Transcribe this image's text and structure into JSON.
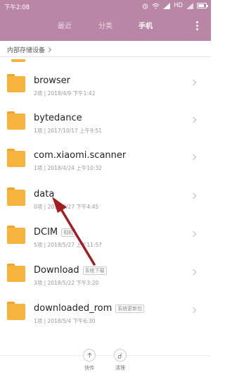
{
  "status": {
    "time": "下午2:08",
    "network": "HD",
    "battery_level": 0.8
  },
  "tabs": [
    {
      "label": "最近",
      "active": false
    },
    {
      "label": "分类",
      "active": false
    },
    {
      "label": "手机",
      "active": true
    }
  ],
  "breadcrumb": {
    "label": "内部存储设备"
  },
  "folders": [
    {
      "name": "browser",
      "tag": "",
      "meta": "2项 | 2018/4/9 下午1:42"
    },
    {
      "name": "bytedance",
      "tag": "",
      "meta": "1项 | 2017/10/17 上午9:51"
    },
    {
      "name": "com.xiaomi.scanner",
      "tag": "",
      "meta": "1项 | 2018/4/24 上午10:32"
    },
    {
      "name": "data",
      "tag": "",
      "meta": "0项 | 2018/9/27 下午4:45"
    },
    {
      "name": "DCIM",
      "tag": "相机",
      "meta": "5项 | 2018/5/27 上午11:57"
    },
    {
      "name": "Download",
      "tag": "系统下载",
      "meta": "3项 | 2018/5/22 下午3:20"
    },
    {
      "name": "downloaded_rom",
      "tag": "系统更新包",
      "meta": "1项 | 2018/5/4 下午6:30"
    }
  ],
  "bottom_bar": {
    "quick_label": "快传",
    "clean_label": "清理"
  },
  "colors": {
    "header": "#ba86a5",
    "folder": "#f6b33e",
    "arrow": "#a01d22"
  }
}
